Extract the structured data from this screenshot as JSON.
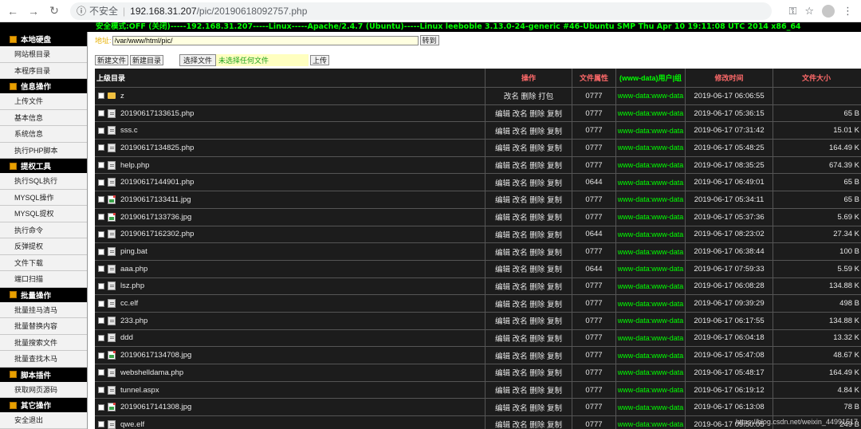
{
  "browser": {
    "back_icon": "←",
    "forward_icon": "→",
    "reload_icon": "↻",
    "info_icon": "ⓘ",
    "insecure_label": "不安全",
    "url_host": "192.168.31.207",
    "url_path": "/pic/20190618092757.php",
    "key_icon": "⚿",
    "star_icon": "☆",
    "menu_icon": "⋮"
  },
  "banner": "安全模式:OFF (关闭)-----192.168.31.207-----Linux-----Apache/2.4.7 (Ubuntu)-----Linux leeboble 3.13.0-24-generic #46-Ubuntu SMP Thu Apr 10 19:11:08 UTC 2014 x86_64",
  "sidebar": {
    "sections": [
      {
        "title": "本地硬盘",
        "items": [
          "网站根目录",
          "本程序目录"
        ]
      },
      {
        "title": "信息操作",
        "items": [
          "上传文件",
          "基本信息",
          "系统信息",
          "执行PHP脚本"
        ]
      },
      {
        "title": "提权工具",
        "items": [
          "执行SQL执行",
          "MYSQL操作",
          "MYSQL提权",
          "执行命令",
          "反弹提权",
          "文件下载",
          "端口扫描"
        ]
      },
      {
        "title": "批量操作",
        "items": [
          "批量挂马清马",
          "批量替换内容",
          "批量搜索文件",
          "批量查找木马"
        ]
      },
      {
        "title": "脚本插件",
        "items": [
          "获取网页源码"
        ]
      },
      {
        "title": "其它操作",
        "items": [
          "安全退出"
        ]
      }
    ]
  },
  "toolbar": {
    "address_label": "地址:",
    "path_value": "/var/www/html/pic/",
    "goto_label": "转到",
    "new_file_label": "新建文件",
    "new_dir_label": "新建目录",
    "choose_file_label": "选择文件",
    "no_file_label": "未选择任何文件",
    "upload_label": "上传"
  },
  "table": {
    "headers": {
      "name": "上级目录",
      "op": "操作",
      "perm": "文件属性",
      "owner": "(www-data)用户|组",
      "time": "修改时间",
      "size": "文件大小"
    },
    "rows": [
      {
        "name": "z",
        "type": "folder",
        "op": "改名 删除 打包",
        "perm": "0777",
        "owner": "www-data:www-data",
        "time": "2019-06-17 06:06:55",
        "size": ""
      },
      {
        "name": "20190617133615.php",
        "type": "doc",
        "op": "编辑 改名 删除 复制",
        "perm": "0777",
        "owner": "www-data:www-data",
        "time": "2019-06-17 05:36:15",
        "size": "65 B"
      },
      {
        "name": "sss.c",
        "type": "doc",
        "op": "编辑 改名 删除 复制",
        "perm": "0777",
        "owner": "www-data:www-data",
        "time": "2019-06-17 07:31:42",
        "size": "15.01 K"
      },
      {
        "name": "20190617134825.php",
        "type": "doc",
        "op": "编辑 改名 删除 复制",
        "perm": "0777",
        "owner": "www-data:www-data",
        "time": "2019-06-17 05:48:25",
        "size": "164.49 K"
      },
      {
        "name": "help.php",
        "type": "doc",
        "op": "编辑 改名 删除 复制",
        "perm": "0777",
        "owner": "www-data:www-data",
        "time": "2019-06-17 08:35:25",
        "size": "674.39 K"
      },
      {
        "name": "20190617144901.php",
        "type": "doc",
        "op": "编辑 改名 删除 复制",
        "perm": "0644",
        "owner": "www-data:www-data",
        "time": "2019-06-17 06:49:01",
        "size": "65 B"
      },
      {
        "name": "20190617133411.jpg",
        "type": "img",
        "op": "编辑 改名 删除 复制",
        "perm": "0777",
        "owner": "www-data:www-data",
        "time": "2019-06-17 05:34:11",
        "size": "65 B"
      },
      {
        "name": "20190617133736.jpg",
        "type": "img",
        "op": "编辑 改名 删除 复制",
        "perm": "0777",
        "owner": "www-data:www-data",
        "time": "2019-06-17 05:37:36",
        "size": "5.69 K"
      },
      {
        "name": "20190617162302.php",
        "type": "doc",
        "op": "编辑 改名 删除 复制",
        "perm": "0644",
        "owner": "www-data:www-data",
        "time": "2019-06-17 08:23:02",
        "size": "27.34 K"
      },
      {
        "name": "ping.bat",
        "type": "doc",
        "op": "编辑 改名 删除 复制",
        "perm": "0777",
        "owner": "www-data:www-data",
        "time": "2019-06-17 06:38:44",
        "size": "100 B"
      },
      {
        "name": "aaa.php",
        "type": "doc",
        "op": "编辑 改名 删除 复制",
        "perm": "0644",
        "owner": "www-data:www-data",
        "time": "2019-06-17 07:59:33",
        "size": "5.59 K"
      },
      {
        "name": "lsz.php",
        "type": "doc",
        "op": "编辑 改名 删除 复制",
        "perm": "0777",
        "owner": "www-data:www-data",
        "time": "2019-06-17 06:08:28",
        "size": "134.88 K"
      },
      {
        "name": "cc.elf",
        "type": "doc",
        "op": "编辑 改名 删除 复制",
        "perm": "0777",
        "owner": "www-data:www-data",
        "time": "2019-06-17 09:39:29",
        "size": "498 B"
      },
      {
        "name": "233.php",
        "type": "doc",
        "op": "编辑 改名 删除 复制",
        "perm": "0777",
        "owner": "www-data:www-data",
        "time": "2019-06-17 06:17:55",
        "size": "134.88 K"
      },
      {
        "name": "ddd",
        "type": "doc",
        "op": "编辑 改名 删除 复制",
        "perm": "0777",
        "owner": "www-data:www-data",
        "time": "2019-06-17 06:04:18",
        "size": "13.32 K"
      },
      {
        "name": "20190617134708.jpg",
        "type": "img",
        "op": "编辑 改名 删除 复制",
        "perm": "0777",
        "owner": "www-data:www-data",
        "time": "2019-06-17 05:47:08",
        "size": "48.67 K"
      },
      {
        "name": "webshelldama.php",
        "type": "doc",
        "op": "编辑 改名 删除 复制",
        "perm": "0777",
        "owner": "www-data:www-data",
        "time": "2019-06-17 05:48:17",
        "size": "164.49 K"
      },
      {
        "name": "tunnel.aspx",
        "type": "doc",
        "op": "编辑 改名 删除 复制",
        "perm": "0777",
        "owner": "www-data:www-data",
        "time": "2019-06-17 06:19:12",
        "size": "4.84 K"
      },
      {
        "name": "20190617141308.jpg",
        "type": "img",
        "op": "编辑 改名 删除 复制",
        "perm": "0777",
        "owner": "www-data:www-data",
        "time": "2019-06-17 06:13:08",
        "size": "78 B"
      },
      {
        "name": "qwe.elf",
        "type": "doc",
        "op": "编辑 改名 删除 复制",
        "perm": "0777",
        "owner": "www-data:www-data",
        "time": "2019-06-17 09:50:05",
        "size": "249 B"
      }
    ]
  },
  "watermark": "https://blog.csdn.net/weixin_44991517"
}
